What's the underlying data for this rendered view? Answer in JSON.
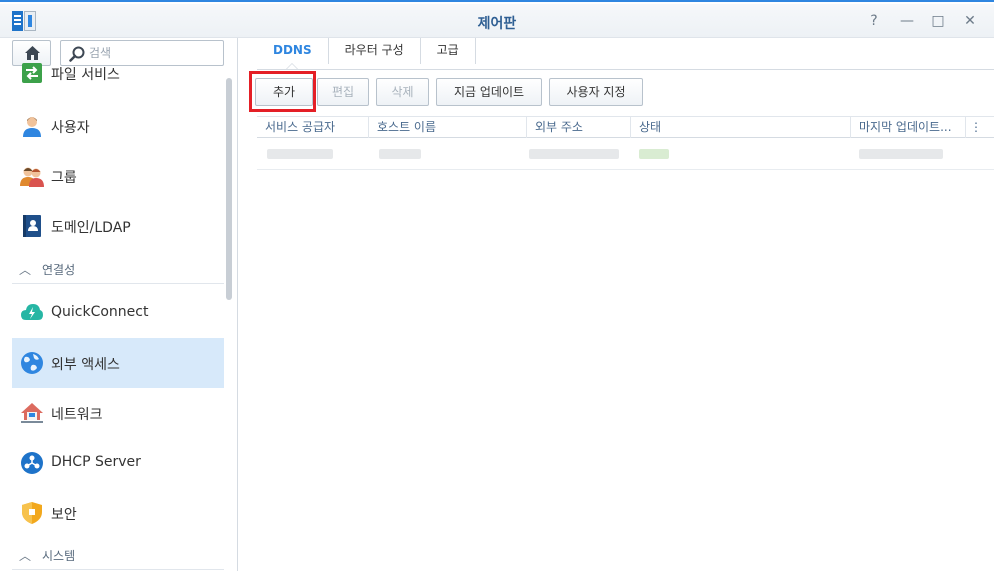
{
  "window": {
    "title": "제어판"
  },
  "window_controls": [
    "?",
    "—",
    "□",
    "✕"
  ],
  "sidebar": {
    "search_placeholder": "검색",
    "items": [
      {
        "label": "파일 서비스",
        "icon": "file-services-icon"
      },
      {
        "label": "사용자",
        "icon": "user-icon"
      },
      {
        "label": "그룹",
        "icon": "group-icon"
      },
      {
        "label": "도메인/LDAP",
        "icon": "domain-ldap-icon"
      }
    ],
    "section_connectivity": "연결성",
    "conn_items": [
      {
        "label": "QuickConnect",
        "icon": "quickconnect-icon"
      },
      {
        "label": "외부 액세스",
        "icon": "external-access-icon",
        "active": true
      },
      {
        "label": "네트워크",
        "icon": "network-icon"
      },
      {
        "label": "DHCP Server",
        "icon": "dhcp-server-icon"
      },
      {
        "label": "보안",
        "icon": "security-icon"
      }
    ],
    "section_system": "시스템"
  },
  "tabs": [
    {
      "label": "DDNS",
      "active": true
    },
    {
      "label": "라우터 구성"
    },
    {
      "label": "고급"
    }
  ],
  "toolbar": {
    "add": "추가",
    "edit": "편집",
    "delete": "삭제",
    "update_now": "지금 업데이트",
    "customize": "사용자 지정"
  },
  "grid": {
    "columns": [
      "서비스 공급자",
      "호스트 이름",
      "외부 주소",
      "상태",
      "마지막 업데이트...",
      "⋮"
    ]
  },
  "colors": {
    "accent": "#2f86e0",
    "active_item_bg": "#d7e9fa",
    "highlight_box": "#e41f26"
  }
}
